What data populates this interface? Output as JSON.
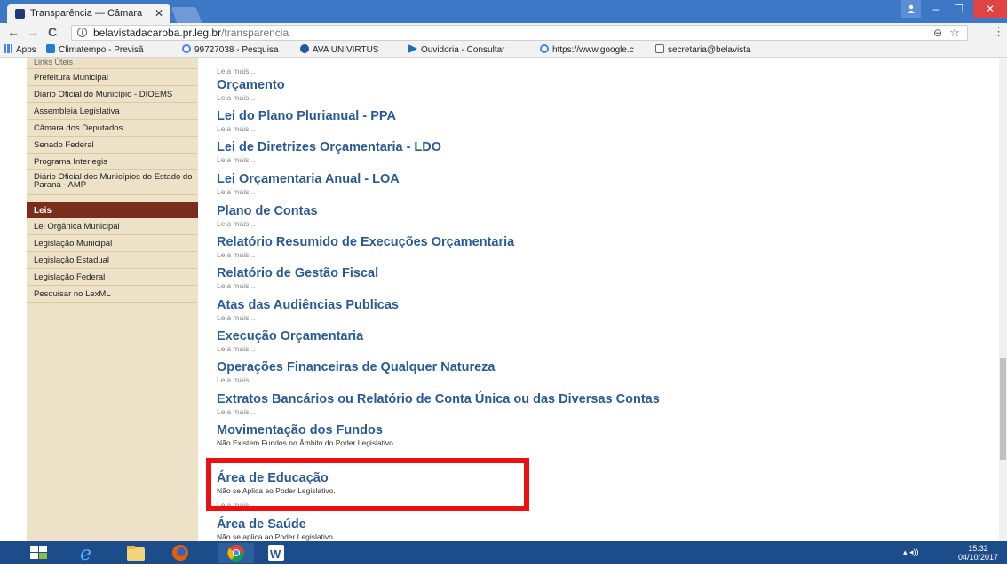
{
  "browser": {
    "tab_title": "Transparência — Câmara",
    "tab_close": "✕",
    "url_host": "belavistadacaroba.pr.leg.br",
    "url_path": "/transparencia",
    "win_minimize": "–",
    "win_restore": "❐",
    "win_close": "✕",
    "back": "←",
    "forward": "→",
    "reload": "C",
    "zoom": "⊖",
    "star": "☆",
    "menu": "⋮",
    "info": "i"
  },
  "bookmarks": [
    {
      "label": "Apps",
      "icon": "apps-icon",
      "color": "#4a4a4a"
    },
    {
      "label": "Climatempo - Previsã",
      "icon": "climatempo-icon",
      "color": "#1e7fd1"
    },
    {
      "label": "99727038 - Pesquisa",
      "icon": "google-icon",
      "color": "#4285f4"
    },
    {
      "label": "AVA UNIVIRTUS",
      "icon": "ava-icon",
      "color": "#2456a8"
    },
    {
      "label": "Ouvidoria - Consultar",
      "icon": "ouvidoria-icon",
      "color": "#1a6fb5"
    },
    {
      "label": "https://www.google.c",
      "icon": "google-icon",
      "color": "#4285f4"
    },
    {
      "label": "secretaria@belavista",
      "icon": "mail-icon",
      "color": "#666666"
    }
  ],
  "sidebar": {
    "top_clipped": "Links Úteis",
    "links": [
      "Prefeitura Municipal",
      "Diario Oficial do Município - DIOEMS",
      "Assembleia Legislativa",
      "Câmara dos Deputados",
      "Senado Federal",
      "Programa Interlegis",
      "Diário Oficial dos Municípios do Estado do Paraná - AMP"
    ],
    "leis_header": "Leis",
    "leis": [
      "Lei Orgânica Municipal",
      "Legislação Municipal",
      "Legislação Estadual",
      "Legislação Federal",
      "Pesquisar no LexML"
    ]
  },
  "content": {
    "top_leia": "Leia mais...",
    "entries": [
      {
        "title": "Orçamento",
        "sub": "Leia mais..."
      },
      {
        "title": "Lei do Plano Plurianual - PPA",
        "sub": "Leia mais..."
      },
      {
        "title": "Lei de Diretrizes Orçamentaria - LDO",
        "sub": "Leia mais..."
      },
      {
        "title": "Lei Orçamentaria Anual - LOA",
        "sub": "Leia mais..."
      },
      {
        "title": "Plano de Contas",
        "sub": "Leia mais..."
      },
      {
        "title": "Relatório Resumido de Execuções Orçamentaria",
        "sub": "Leia mais..."
      },
      {
        "title": "Relatório de Gestão Fiscal",
        "sub": "Leia mais..."
      },
      {
        "title": "Atas das Audiências Publicas",
        "sub": "Leia mais..."
      },
      {
        "title": "Execução Orçamentaria",
        "sub": "Leia mais..."
      },
      {
        "title": "Operações Financeiras de Qualquer Natureza",
        "sub": "Leia mais..."
      },
      {
        "title": "Extratos Bancários ou Relatório de Conta Única ou das Diversas Contas",
        "sub": "Leia mais..."
      },
      {
        "title": "Movimentação dos Fundos",
        "desc": "Não Existem Fundos no Âmbito do Poder Legislativo."
      },
      {
        "title": "Área de Educação",
        "desc": "Não se Aplica ao Poder Legislativo.",
        "sub": "Leia mais..."
      },
      {
        "title": "Área de Saúde",
        "desc": "Não se aplica ao Poder Legislativo."
      }
    ]
  },
  "taskbar": {
    "time": "15:32",
    "date": "04/10/2017",
    "tray": "▴ ◂))"
  },
  "colors": {
    "accent_title": "#2a5a95",
    "sidebar_bg": "#ede2c8",
    "sidebar_header": "#7a2d1d",
    "highlight": "#ee1010"
  }
}
